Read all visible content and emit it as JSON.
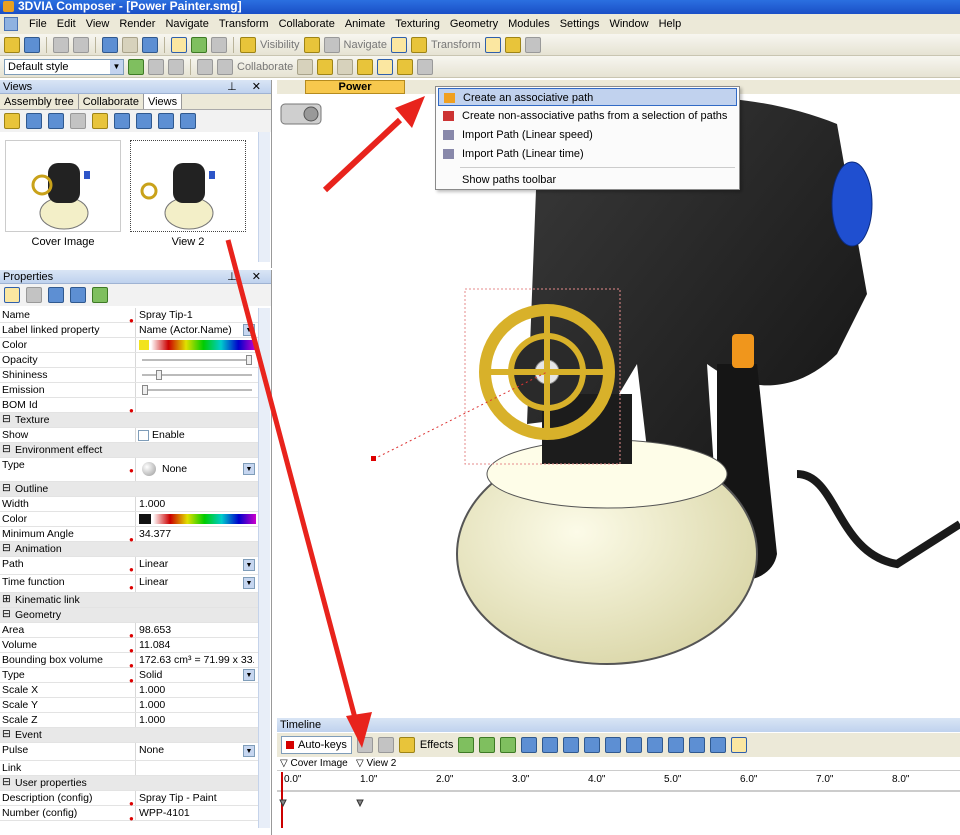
{
  "window": {
    "title": "3DVIA Composer - [Power Painter.smg]"
  },
  "menu": [
    "File",
    "Edit",
    "View",
    "Render",
    "Navigate",
    "Transform",
    "Collaborate",
    "Animate",
    "Texturing",
    "Geometry",
    "Modules",
    "Settings",
    "Window",
    "Help"
  ],
  "toolbar1": {
    "visibility_label": "Visibility",
    "navigate_label": "Navigate",
    "transform_label": "Transform"
  },
  "toolbar2": {
    "style_value": "Default style",
    "collaborate_label": "Collaborate"
  },
  "views_panel": {
    "title": "Views",
    "tabs": [
      "Assembly tree",
      "Collaborate",
      "Views"
    ],
    "thumbs": [
      {
        "label": "Cover Image"
      },
      {
        "label": "View 2"
      }
    ]
  },
  "properties_panel": {
    "title": "Properties",
    "rows": [
      {
        "k": "Name",
        "v": "Spray Tip-1"
      },
      {
        "k": "Label linked property",
        "v": "Name (Actor.Name)"
      },
      {
        "k": "Color",
        "v": ""
      },
      {
        "k": "Opacity",
        "v": ""
      },
      {
        "k": "Shininess",
        "v": ""
      },
      {
        "k": "Emission",
        "v": ""
      },
      {
        "k": "BOM Id",
        "v": ""
      },
      {
        "k": "Texture",
        "v": ""
      },
      {
        "k": "Show",
        "v": "Enable"
      },
      {
        "k": "Environment effect",
        "v": ""
      },
      {
        "k": "Type",
        "v": "None"
      },
      {
        "k": "Outline",
        "v": ""
      },
      {
        "k": "Width",
        "v": "1.000"
      },
      {
        "k": "Color",
        "v": ""
      },
      {
        "k": "Minimum Angle",
        "v": "34.377"
      },
      {
        "k": "Animation",
        "v": ""
      },
      {
        "k": "Path",
        "v": "Linear"
      },
      {
        "k": "Time function",
        "v": "Linear"
      },
      {
        "k": "Kinematic link",
        "v": ""
      },
      {
        "k": "Geometry",
        "v": ""
      },
      {
        "k": "Area",
        "v": "98.653"
      },
      {
        "k": "Volume",
        "v": "11.084"
      },
      {
        "k": "Bounding box volume",
        "v": "172.63 cm³ = 71.99 x 33...."
      },
      {
        "k": "Type",
        "v": "Solid"
      },
      {
        "k": "Scale X",
        "v": "1.000"
      },
      {
        "k": "Scale Y",
        "v": "1.000"
      },
      {
        "k": "Scale Z",
        "v": "1.000"
      },
      {
        "k": "Event",
        "v": ""
      },
      {
        "k": "Pulse",
        "v": "None"
      },
      {
        "k": "Link",
        "v": ""
      },
      {
        "k": "User properties",
        "v": ""
      },
      {
        "k": "Description (config)",
        "v": "Spray Tip - Paint"
      },
      {
        "k": "Number (config)",
        "v": "WPP-4101"
      }
    ]
  },
  "document_tab": "Power Painter.smg",
  "path_menu": {
    "items": [
      "Create an associative path",
      "Create non-associative paths from a selection of paths",
      "Import Path (Linear speed)",
      "Import Path (Linear time)",
      "Show paths toolbar"
    ]
  },
  "timeline": {
    "title": "Timeline",
    "autokeys_label": "Auto-keys",
    "effects_label": "Effects",
    "view_markers": [
      "Cover Image",
      "View 2"
    ],
    "ticks": [
      "0.0\"",
      "1.0\"",
      "2.0\"",
      "3.0\"",
      "4.0\"",
      "5.0\"",
      "6.0\"",
      "7.0\"",
      "8.0\""
    ]
  },
  "colors": {
    "accent": "#316ac5",
    "arrow": "#e8231c",
    "highlight": "#c1d2ee"
  }
}
